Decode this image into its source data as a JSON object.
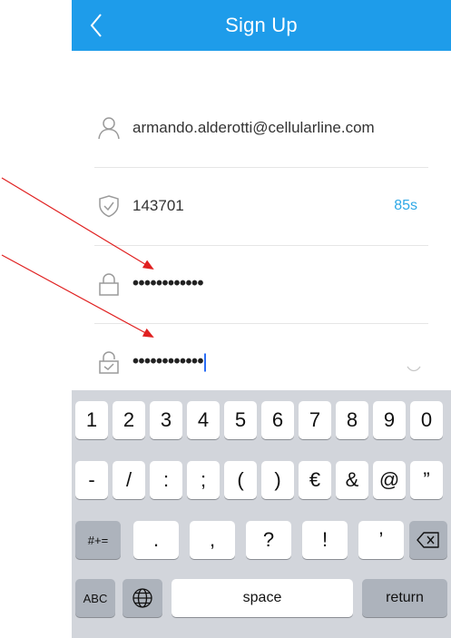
{
  "colors": {
    "accent": "#1e9cea",
    "countdown": "#2ea8e6",
    "annotation": "#e02020"
  },
  "navbar": {
    "title": "Sign Up",
    "back_icon": "chevron-left-icon"
  },
  "form": {
    "email": {
      "value": "armando.alderotti@cellularline.com",
      "icon": "user-icon"
    },
    "code": {
      "value": "143701",
      "countdown": "85s",
      "icon": "shield-check-icon"
    },
    "password": {
      "value": "••••••••••••",
      "icon": "lock-icon"
    },
    "confirm_password": {
      "value": "••••••••••••",
      "icon": "lock-check-icon",
      "toggle_icon": "eye-closed-icon"
    }
  },
  "keyboard": {
    "row1": [
      "1",
      "2",
      "3",
      "4",
      "5",
      "6",
      "7",
      "8",
      "9",
      "0"
    ],
    "row2": [
      "-",
      "/",
      ":",
      ";",
      "(",
      ")",
      "€",
      "&",
      "@",
      "”"
    ],
    "row3": {
      "switch": "#+=",
      "keys": [
        ".",
        ",",
        "?",
        "!",
        "’"
      ],
      "delete_icon": "backspace-icon"
    },
    "row4": {
      "abc": "ABC",
      "globe_icon": "globe-icon",
      "space": "space",
      "return": "return"
    }
  }
}
